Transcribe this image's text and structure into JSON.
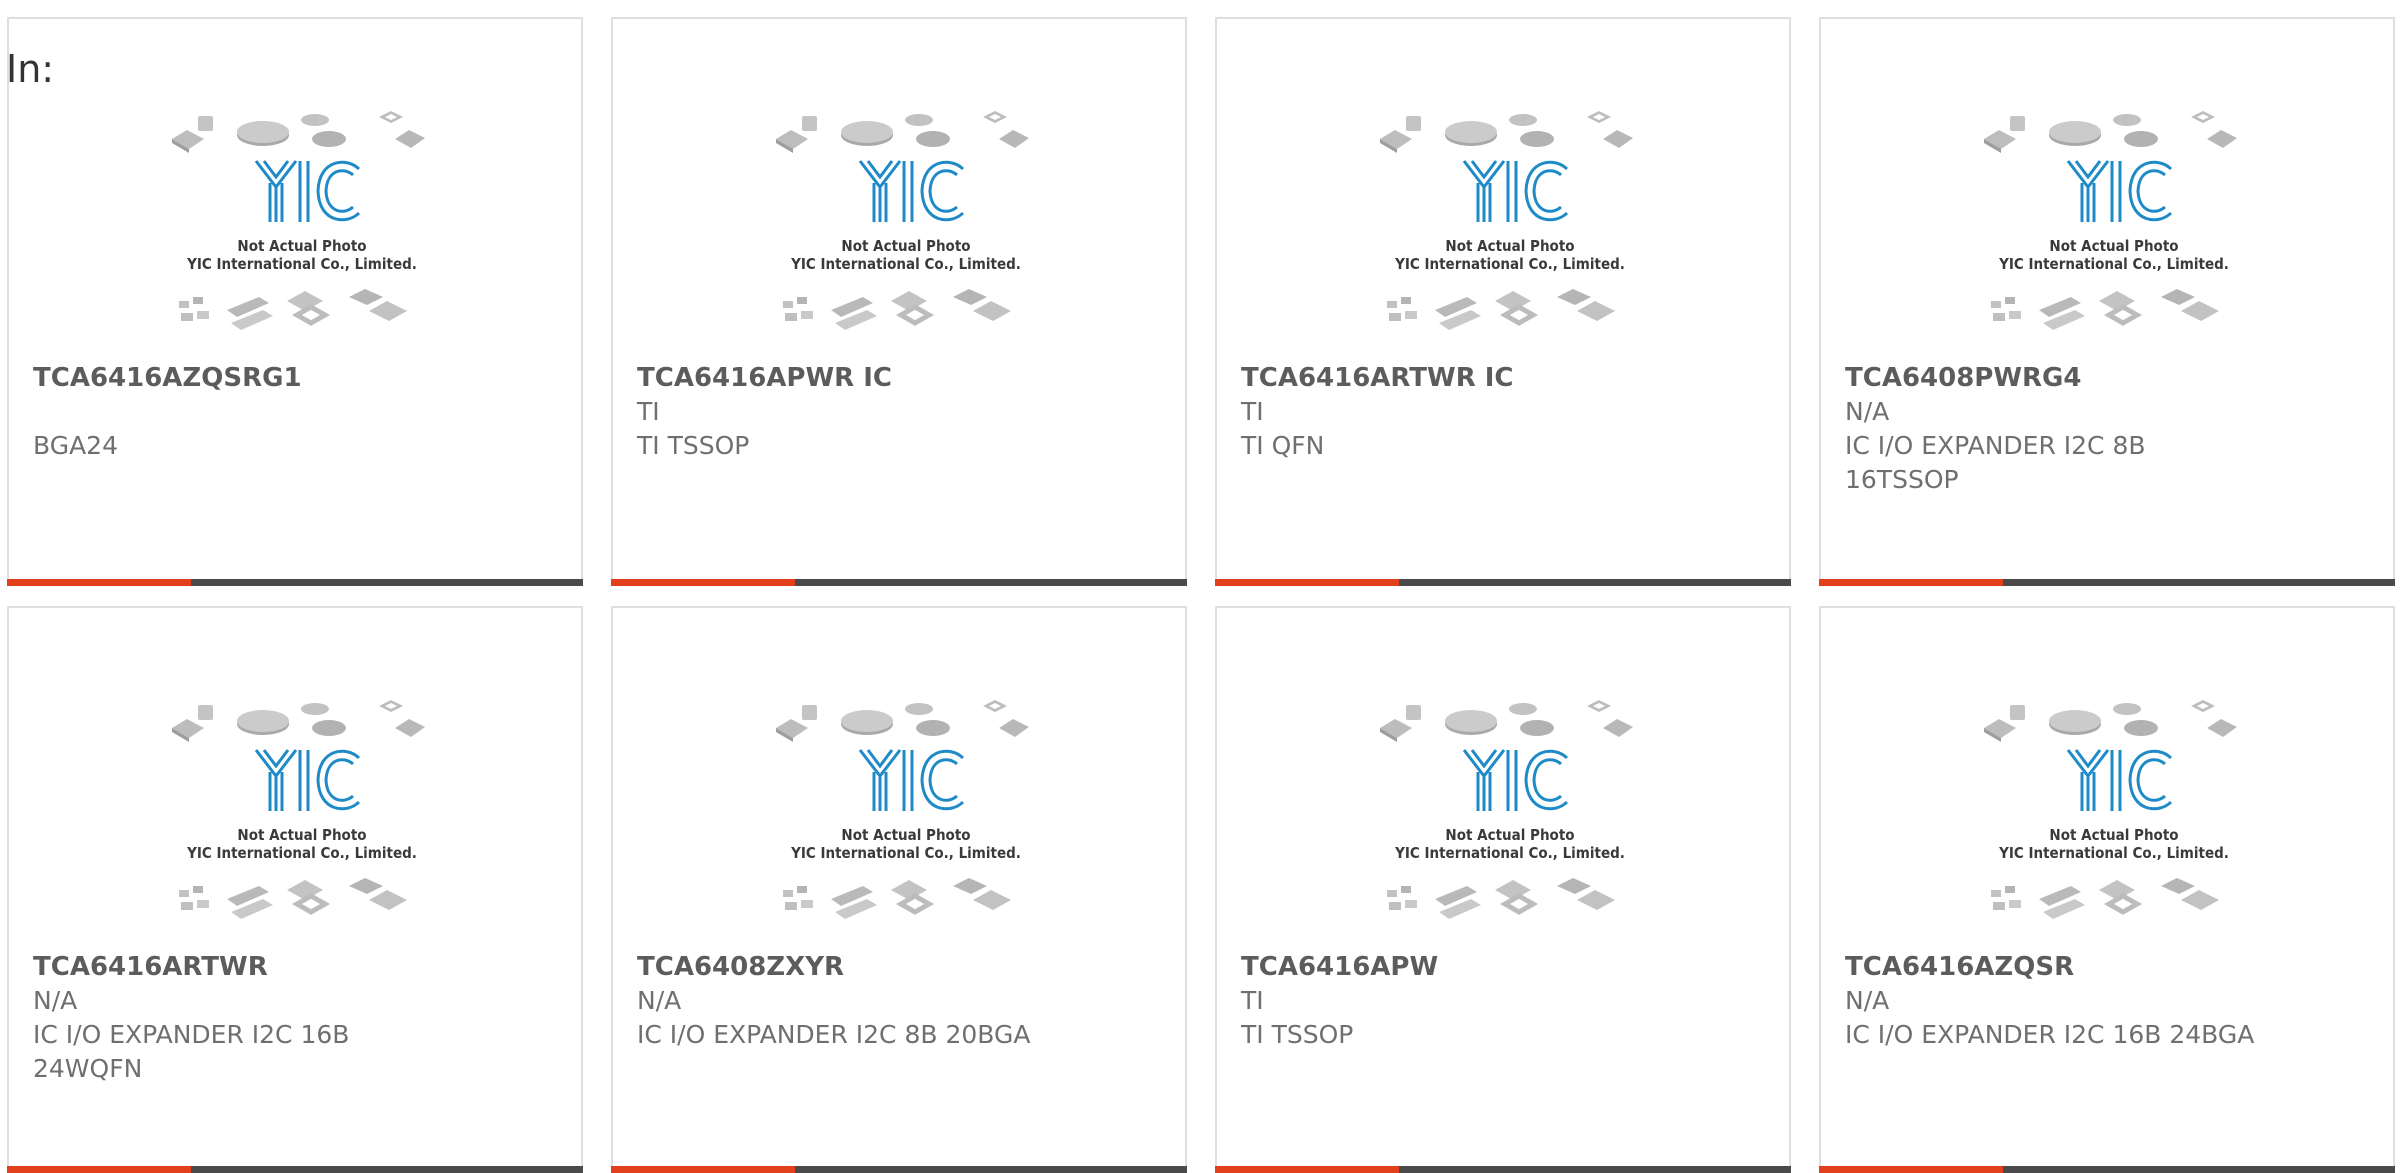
{
  "in_label": "In:",
  "placeholder": {
    "line1": "Not Actual Photo",
    "line2": "YIC International Co., Limited."
  },
  "colors": {
    "accent": "#e2401c",
    "bar": "#4a4a4a",
    "logo": "#1f8ac8"
  },
  "products": [
    {
      "part": "TCA6416AZQSRG1",
      "manufacturer": "",
      "description": "BGA24"
    },
    {
      "part": "TCA6416APWR IC",
      "manufacturer": "TI",
      "description": "TI TSSOP"
    },
    {
      "part": "TCA6416ARTWR IC",
      "manufacturer": "TI",
      "description": "TI QFN"
    },
    {
      "part": "TCA6408PWRG4",
      "manufacturer": "N/A",
      "description": "IC I/O EXPANDER I2C 8B 16TSSOP"
    },
    {
      "part": "TCA6416ARTWR",
      "manufacturer": "N/A",
      "description": "IC I/O EXPANDER I2C 16B 24WQFN"
    },
    {
      "part": "TCA6408ZXYR",
      "manufacturer": "N/A",
      "description": "IC I/O EXPANDER I2C 8B 20BGA"
    },
    {
      "part": "TCA6416APW",
      "manufacturer": "TI",
      "description": "TI TSSOP"
    },
    {
      "part": "TCA6416AZQSR",
      "manufacturer": "N/A",
      "description": "IC I/O EXPANDER I2C 16B 24BGA"
    }
  ]
}
